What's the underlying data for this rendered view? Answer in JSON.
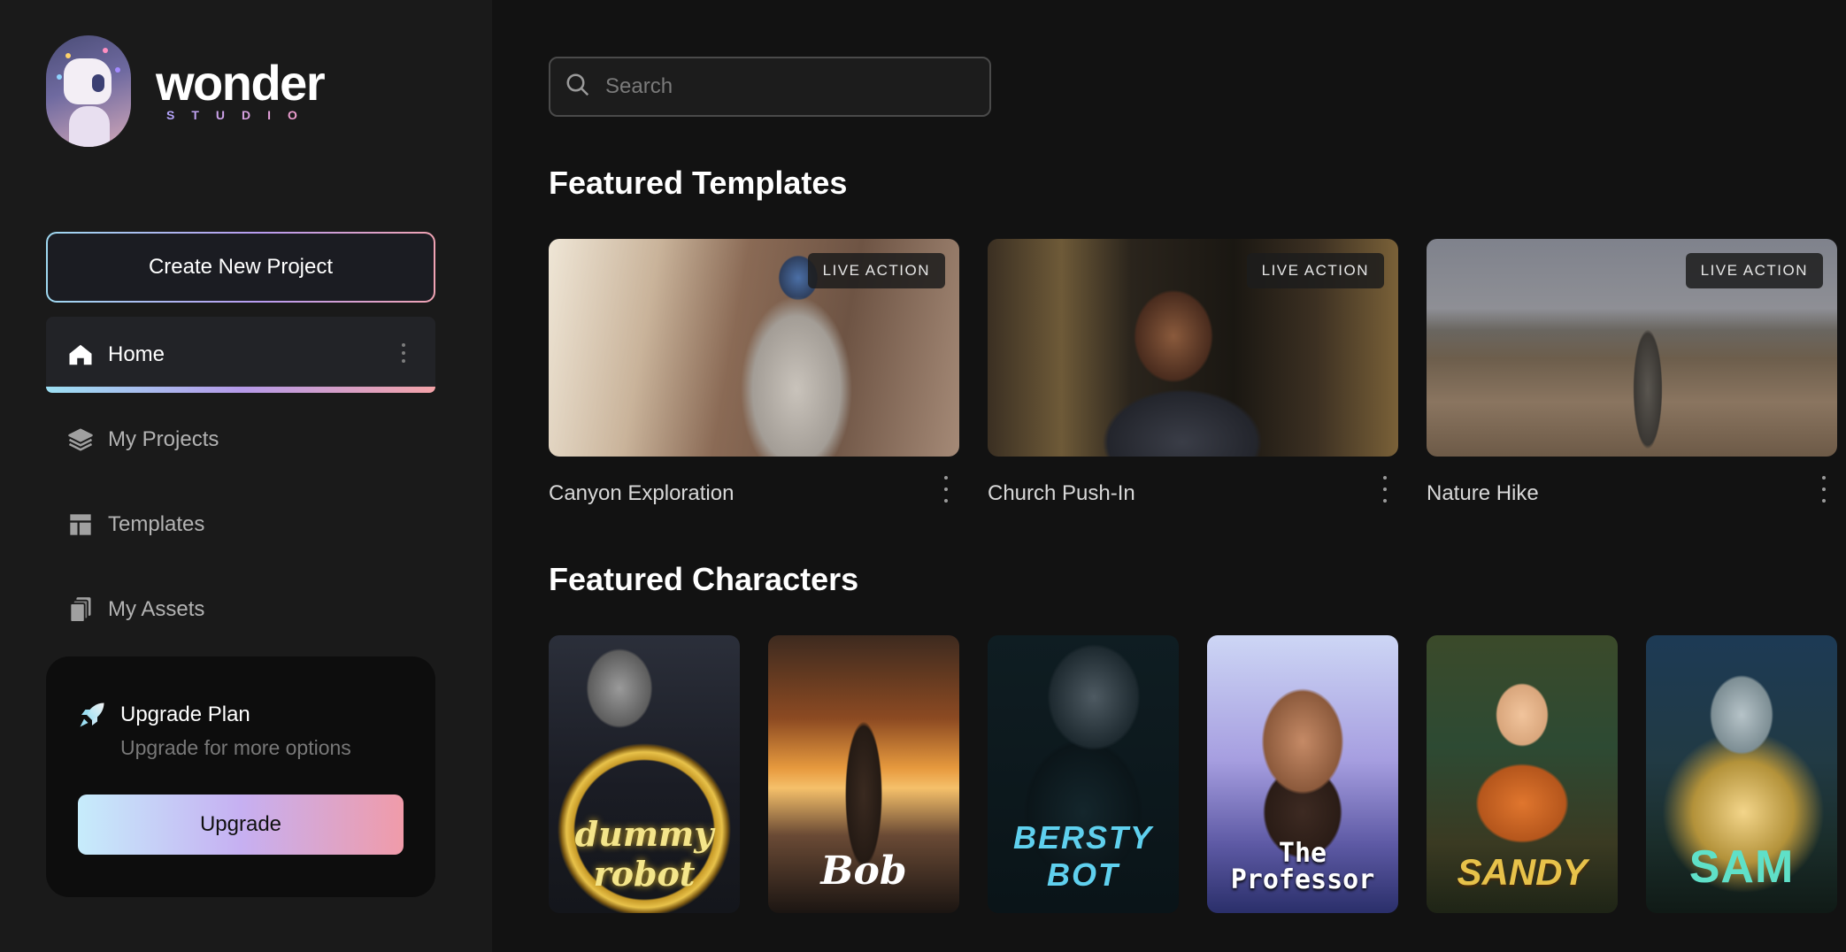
{
  "brand": {
    "name": "wonder",
    "subtitle": "STUDIO"
  },
  "sidebar": {
    "create_label": "Create New Project",
    "items": [
      {
        "label": "Home",
        "icon": "home-icon",
        "active": true
      },
      {
        "label": "My Projects",
        "icon": "layers-icon",
        "active": false
      },
      {
        "label": "Templates",
        "icon": "layout-icon",
        "active": false
      },
      {
        "label": "My Assets",
        "icon": "files-icon",
        "active": false
      }
    ],
    "upgrade": {
      "title": "Upgrade Plan",
      "subtitle": "Upgrade for more options",
      "button": "Upgrade"
    }
  },
  "search": {
    "placeholder": "Search",
    "value": ""
  },
  "featured_templates": {
    "title": "Featured Templates",
    "items": [
      {
        "name": "Canyon Exploration",
        "badge": "LIVE ACTION"
      },
      {
        "name": "Church Push-In",
        "badge": "LIVE ACTION"
      },
      {
        "name": "Nature Hike",
        "badge": "LIVE ACTION"
      }
    ]
  },
  "featured_characters": {
    "title": "Featured Characters",
    "items": [
      {
        "title": "dummy robot"
      },
      {
        "title": "Bob"
      },
      {
        "title": "BERSTY BOT"
      },
      {
        "title": "The Professor"
      },
      {
        "title": "SANDY"
      },
      {
        "title": "SAM"
      }
    ]
  },
  "colors": {
    "accent_gradient": [
      "#9cdff3",
      "#b59ae9",
      "#f4a3a8"
    ],
    "background": "#121212",
    "sidebar": "#1a1a1a"
  }
}
